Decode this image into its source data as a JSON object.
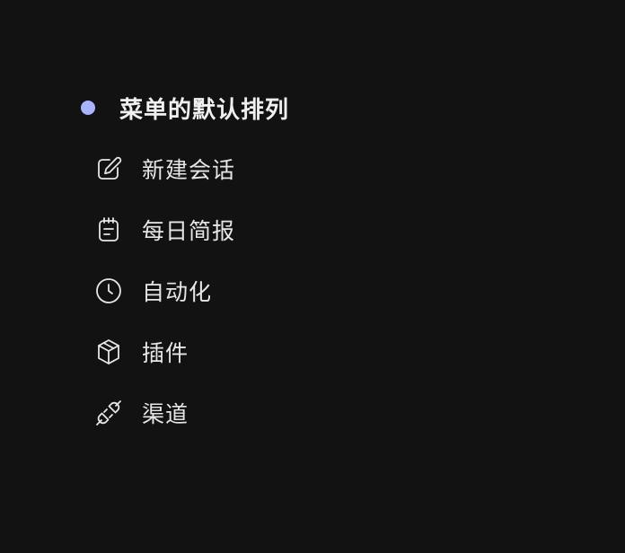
{
  "section": {
    "title": "菜单的默认排列",
    "dot_color": "#a9b4ff"
  },
  "menu": {
    "items": [
      {
        "label": "新建会话",
        "icon": "edit-icon"
      },
      {
        "label": "每日简报",
        "icon": "notepad-icon"
      },
      {
        "label": "自动化",
        "icon": "clock-icon"
      },
      {
        "label": "插件",
        "icon": "cube-icon"
      },
      {
        "label": "渠道",
        "icon": "plug-icon"
      }
    ]
  },
  "theme": {
    "background": "#121212",
    "text": "#e6e6e6"
  }
}
